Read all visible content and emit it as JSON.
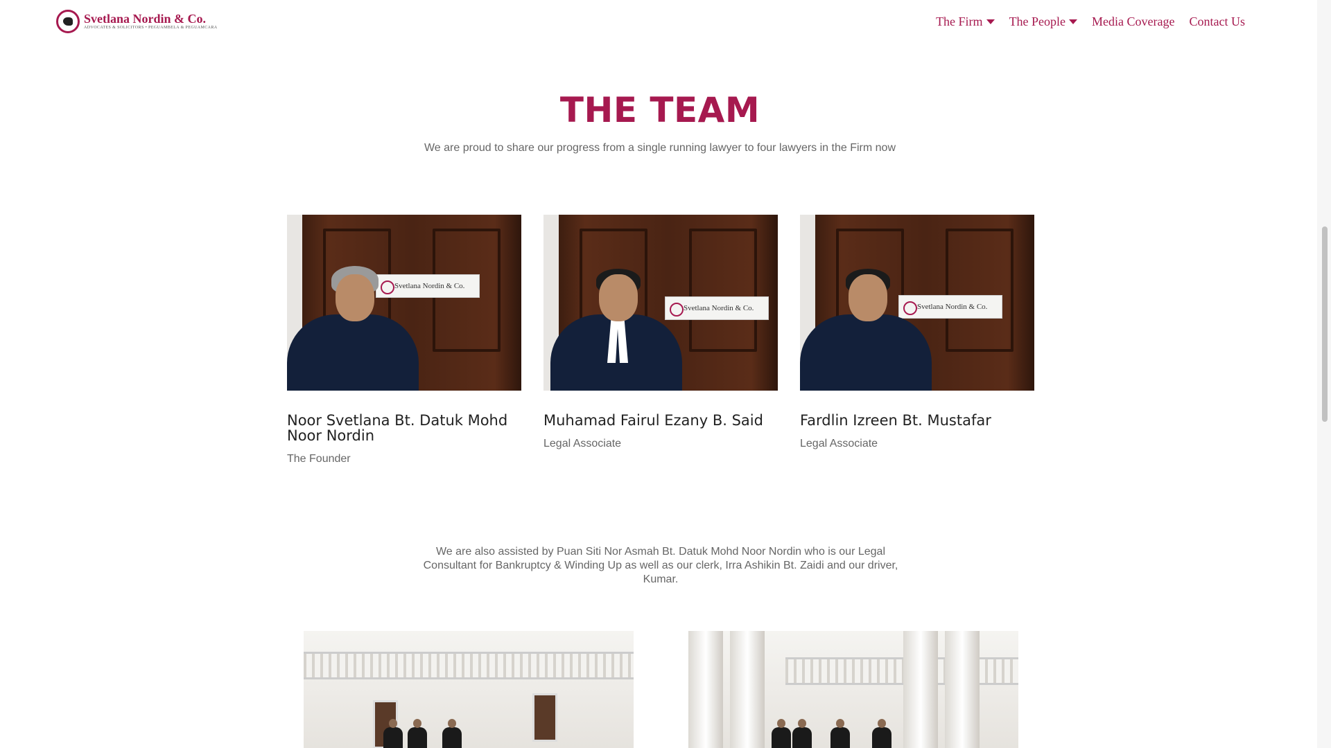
{
  "header": {
    "logo": {
      "name": "Svetlana Nordin & Co.",
      "tagline": "ADVOCATES & SOLICITORS • PEGUAMBELA & PEGUAMCARA"
    },
    "nav": [
      {
        "label": "The Firm",
        "has_dropdown": true
      },
      {
        "label": "The People",
        "has_dropdown": true
      },
      {
        "label": "Media Coverage",
        "has_dropdown": false
      },
      {
        "label": "Contact Us",
        "has_dropdown": false
      }
    ]
  },
  "main": {
    "title": "THE TEAM",
    "subtitle": "We are proud to share our progress from a single running lawyer to four lawyers in the Firm now",
    "team": [
      {
        "name": "Noor Svetlana Bt. Datuk Mohd Noor Nordin",
        "role": "The Founder",
        "plate": "Svetlana Nordin & Co."
      },
      {
        "name": "Muhamad Fairul Ezany B. Said",
        "role": "Legal Associate",
        "plate": "Svetlana Nordin & Co."
      },
      {
        "name": "Fardlin Izreen Bt. Mustafar",
        "role": "Legal Associate",
        "plate": "Svetlana Nordin & Co."
      }
    ],
    "assisted_text": "We are also assisted by Puan Siti Nor Asmah Bt. Datuk Mohd Noor Nordin who is our Legal Consultant for Bankruptcy & Winding Up as well as  our clerk, Irra Ashikin Bt. Zaidi and our driver, Kumar."
  },
  "colors": {
    "brand": "#a6194f",
    "text_muted": "#666666",
    "text_dark": "#222222"
  }
}
